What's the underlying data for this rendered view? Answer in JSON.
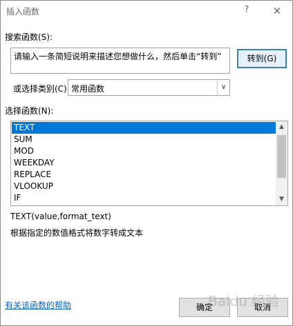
{
  "window": {
    "title": "插入函数",
    "help_glyph": "?",
    "close_glyph": "✕"
  },
  "search": {
    "label": "搜索函数(S):",
    "value": "请输入一条简短说明来描述您想做什么，然后单击“转到”",
    "goto_label": "转到(G)"
  },
  "category": {
    "label": "或选择类别(C):",
    "value": "常用函数",
    "arrow_glyph": "∨"
  },
  "functions": {
    "label": "选择函数(N):",
    "items": [
      "TEXT",
      "SUM",
      "MOD",
      "WEEKDAY",
      "REPLACE",
      "VLOOKUP",
      "IF"
    ],
    "selected_index": 0,
    "scroll_up_glyph": "▲",
    "scroll_down_glyph": "▼"
  },
  "selected_function": {
    "signature": "TEXT(value,format_text)",
    "description": "根据指定的数值格式将数字转成文本"
  },
  "footer": {
    "help_link": "有关该函数的帮助",
    "ok_label": "确定",
    "cancel_label": "取消"
  },
  "watermark": "Baidu 经验"
}
